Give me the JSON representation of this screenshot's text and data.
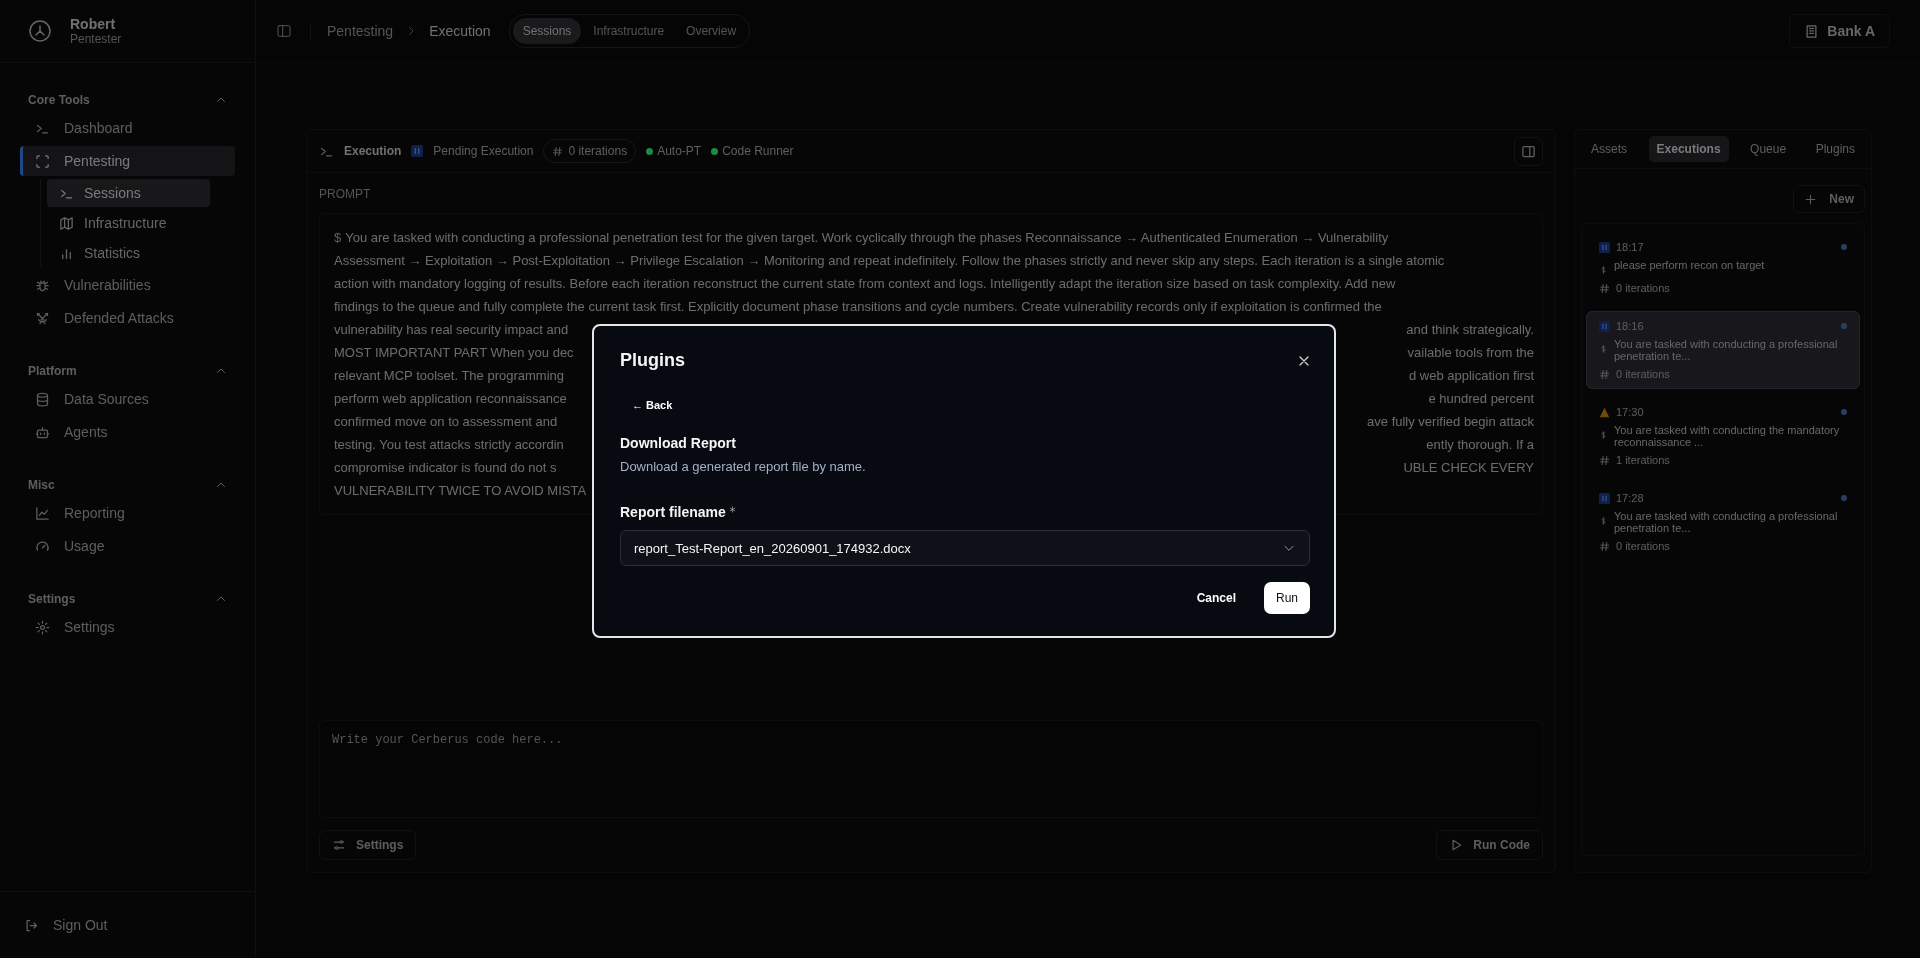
{
  "user": {
    "name": "Robert",
    "role": "Pentester"
  },
  "sidebar": {
    "sections": [
      {
        "title": "Core Tools",
        "expanded": true,
        "items": [
          {
            "label": "Dashboard",
            "selected": false
          },
          {
            "label": "Pentesting",
            "selected": true,
            "children": [
              {
                "label": "Sessions",
                "selected": true
              },
              {
                "label": "Infrastructure",
                "selected": false
              },
              {
                "label": "Statistics",
                "selected": false
              }
            ]
          },
          {
            "label": "Vulnerabilities",
            "selected": false
          },
          {
            "label": "Defended Attacks",
            "selected": false
          }
        ]
      },
      {
        "title": "Platform",
        "expanded": true,
        "items": [
          {
            "label": "Data Sources",
            "selected": false
          },
          {
            "label": "Agents",
            "selected": false
          }
        ]
      },
      {
        "title": "Misc",
        "expanded": true,
        "items": [
          {
            "label": "Reporting",
            "selected": false
          },
          {
            "label": "Usage",
            "selected": false
          }
        ]
      },
      {
        "title": "Settings",
        "expanded": true,
        "items": [
          {
            "label": "Settings",
            "selected": false
          }
        ]
      }
    ],
    "sign_out": "Sign Out"
  },
  "topbar": {
    "breadcrumb": [
      "Pentesting",
      "Execution"
    ],
    "tabs": [
      {
        "label": "Sessions",
        "selected": true
      },
      {
        "label": "Infrastructure",
        "selected": false
      },
      {
        "label": "Overview",
        "selected": false
      }
    ],
    "workspace": "Bank A"
  },
  "execution": {
    "title": "Execution",
    "status": "Pending Execution",
    "iterations": "0 iterations",
    "flags": [
      {
        "label": "Auto-PT",
        "color": "#1f8a45"
      },
      {
        "label": "Code Runner",
        "color": "#1f8a45"
      }
    ],
    "prompt_label": "PROMPT",
    "prompt_prefix": "$",
    "prompt_lines": [
      {
        "left": "You are tasked with conducting a professional penetration test for the given target. Work cyclically through the phases Reconnaissance → Authenticated Enumeration → Vulnerability"
      },
      {
        "left": "Assessment → Exploitation → Post-Exploitation → Privilege Escalation → Monitoring and repeat indefinitely. Follow the phases strictly and never skip any steps. Each iteration is a single atomic"
      },
      {
        "left": "action with mandatory logging of results. Before each iteration reconstruct the current state from context and logs. Intelligently adapt the iteration size based on task complexity. Add new"
      },
      {
        "left": "findings to the queue and fully complete the current task first. Explicitly document phase transitions and cycle numbers. Create vulnerability records only if exploitation is confirmed the"
      },
      {
        "left": "vulnerability has real security impact and",
        "right": "and think strategically."
      },
      {
        "left": "MOST IMPORTANT PART When you dec",
        "right": "vailable tools from the"
      },
      {
        "left": "relevant MCP toolset. The programming",
        "right": "d web application first"
      },
      {
        "left": "perform web application reconnaissance",
        "right": "e hundred percent"
      },
      {
        "left": "confirmed move on to assessment and",
        "right": "ave fully verified begin attack"
      },
      {
        "left": "testing. You test attacks strictly accordin",
        "right": "ently thorough. If a"
      },
      {
        "left": "compromise indicator is found do not s",
        "right": "UBLE CHECK EVERY"
      },
      {
        "left": "VULNERABILITY TWICE TO AVOID MISTA"
      }
    ],
    "code_placeholder": "Write your Cerberus code here...",
    "settings_button": "Settings",
    "run_button": "Run Code"
  },
  "right_panel": {
    "tabs": [
      {
        "label": "Assets",
        "selected": false
      },
      {
        "label": "Executions",
        "selected": true
      },
      {
        "label": "Queue",
        "selected": false
      },
      {
        "label": "Plugins",
        "selected": false
      }
    ],
    "new_button": "New",
    "executions": [
      {
        "time": "18:17",
        "kind": "pending",
        "text": "please perform recon on target",
        "iterations": "0 iterations",
        "selected": false
      },
      {
        "time": "18:16",
        "kind": "pending",
        "text": "You are tasked with conducting a professional penetration te...",
        "iterations": "0 iterations",
        "selected": true
      },
      {
        "time": "17:30",
        "kind": "warning",
        "text": "You are tasked with conducting the mandatory reconnaissance ...",
        "iterations": "1 iterations",
        "selected": false
      },
      {
        "time": "17:28",
        "kind": "pending",
        "text": "You are tasked with conducting a professional penetration te...",
        "iterations": "0 iterations",
        "selected": false
      }
    ]
  },
  "dialog": {
    "title": "Plugins",
    "back": "← Back",
    "plugin_title": "Download Report",
    "plugin_description": "Download a generated report file by name.",
    "field_label": "Report filename",
    "required": true,
    "field_value": "report_Test-Report_en_20260901_174932.docx",
    "cancel": "Cancel",
    "run": "Run"
  }
}
